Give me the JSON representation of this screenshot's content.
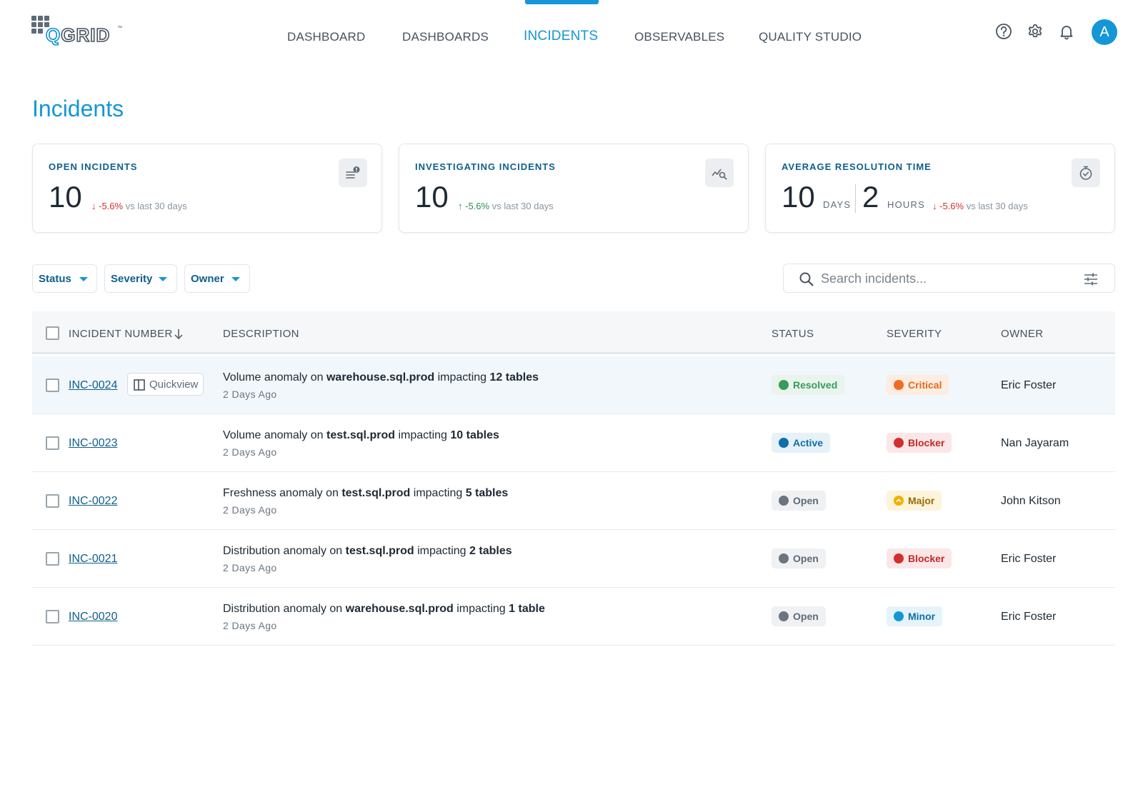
{
  "app": {
    "logo_text": "QGRID",
    "logo_tm": "™"
  },
  "nav": {
    "items": [
      {
        "label": "DASHBOARD"
      },
      {
        "label": "DASHBOARDS"
      },
      {
        "label": "INCIDENTS",
        "active": true
      },
      {
        "label": "OBSERVABLES"
      },
      {
        "label": "QUALITY STUDIO"
      }
    ]
  },
  "header_icons": [
    "help-icon",
    "gear-icon",
    "bell-icon"
  ],
  "user": {
    "avatar_initial": "A"
  },
  "page": {
    "title": "Incidents"
  },
  "cards": [
    {
      "label": "OPEN INCIDENTS",
      "value": "10",
      "trend_arrow": "↓",
      "trend_value": "-5.6%",
      "trend_direction": "down",
      "trend_suffix": "vs last 30 days",
      "icon": "incident-list-icon"
    },
    {
      "label": "INVESTIGATING INCIDENTS",
      "value": "10",
      "trend_arrow": "↑",
      "trend_value": "-5.6%",
      "trend_direction": "up",
      "trend_suffix": "vs last 30 days",
      "icon": "chart-search-icon"
    },
    {
      "label": "AVERAGE RESOLUTION TIME",
      "days_value": "10",
      "days_unit": "DAYS",
      "hours_value": "2",
      "hours_unit": "HOURS",
      "trend_arrow": "↓",
      "trend_value": "-5.6%",
      "trend_direction": "down",
      "trend_suffix": "vs last 30 days",
      "icon": "stopwatch-icon"
    }
  ],
  "filters": [
    {
      "label": "Status"
    },
    {
      "label": "Severity"
    },
    {
      "label": "Owner"
    }
  ],
  "search": {
    "placeholder": "Search incidents..."
  },
  "table": {
    "columns": {
      "incident_number": "INCIDENT NUMBER",
      "description": "DESCRIPTION",
      "status": "STATUS",
      "severity": "SEVERITY",
      "owner": "OWNER"
    },
    "quickview_label": "Quickview",
    "rows": [
      {
        "id": "INC-0024",
        "desc_pre": "Volume anomaly on ",
        "desc_target": "warehouse.sql.prod",
        "desc_mid": " impacting ",
        "desc_count": "12 tables",
        "age": "2 Days Ago",
        "status": "Resolved",
        "severity": "Critical",
        "owner": "Eric Foster"
      },
      {
        "id": "INC-0023",
        "desc_pre": "Volume anomaly on ",
        "desc_target": "test.sql.prod",
        "desc_mid": " impacting ",
        "desc_count": "10 tables",
        "age": "2 Days Ago",
        "status": "Active",
        "severity": "Blocker",
        "owner": "Nan Jayaram"
      },
      {
        "id": "INC-0022",
        "desc_pre": "Freshness anomaly on ",
        "desc_target": "test.sql.prod",
        "desc_mid": " impacting ",
        "desc_count": "5 tables",
        "age": "2 Days Ago",
        "status": "Open",
        "severity": "Major",
        "owner": "John Kitson"
      },
      {
        "id": "INC-0021",
        "desc_pre": "Distribution anomaly on ",
        "desc_target": "test.sql.prod",
        "desc_mid": " impacting ",
        "desc_count": "2 tables",
        "age": "2 Days Ago",
        "status": "Open",
        "severity": "Blocker",
        "owner": "Eric Foster"
      },
      {
        "id": "INC-0020",
        "desc_pre": "Distribution anomaly on ",
        "desc_target": "warehouse.sql.prod",
        "desc_mid": " impacting ",
        "desc_count": "1 table",
        "age": "2 Days Ago",
        "status": "Open",
        "severity": "Minor",
        "owner": "Eric Foster"
      }
    ]
  },
  "colors": {
    "accent": "#1596d6",
    "status_resolved": "#3a9a5c",
    "status_active": "#0f6fa8",
    "status_open": "#6b7580",
    "sev_critical": "#f26b21",
    "sev_blocker": "#d32f2f",
    "sev_major": "#f2b100",
    "sev_minor": "#1596d6"
  }
}
